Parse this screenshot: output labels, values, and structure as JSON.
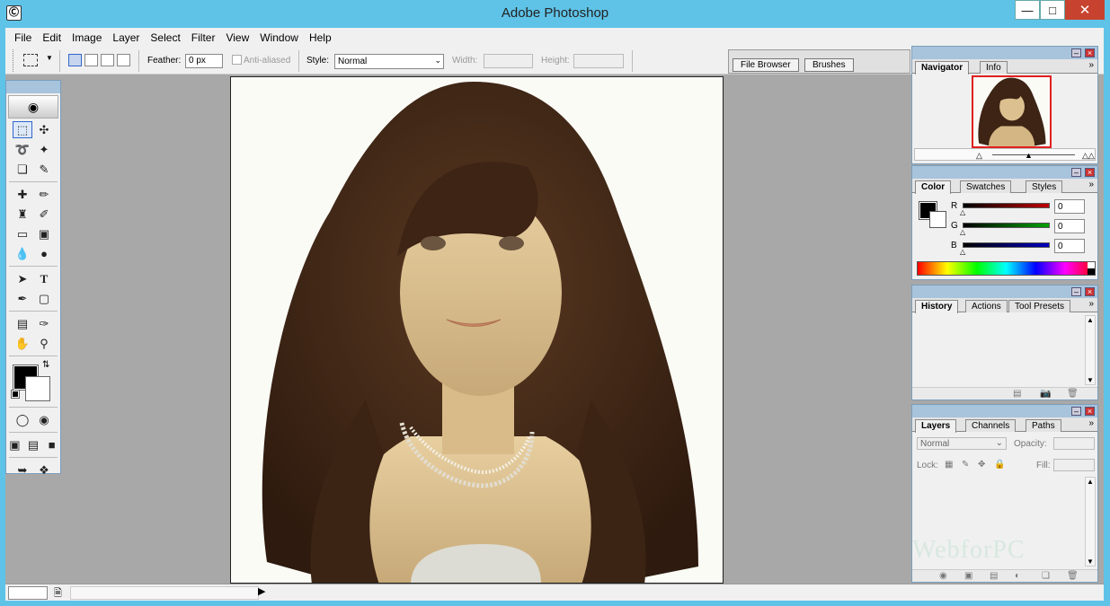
{
  "app": {
    "title": "Adobe Photoshop",
    "icon": "photoshop-icon"
  },
  "window_controls": {
    "minimize": "—",
    "maximize": "□",
    "close": "✕"
  },
  "menu": [
    "File",
    "Edit",
    "Image",
    "Layer",
    "Select",
    "Filter",
    "View",
    "Window",
    "Help"
  ],
  "options": {
    "feather_label": "Feather:",
    "feather_value": "0 px",
    "antialiased_label": "Anti-aliased",
    "style_label": "Style:",
    "style_value": "Normal",
    "width_label": "Width:",
    "height_label": "Height:"
  },
  "palette_well": {
    "tabs": [
      "File Browser",
      "Brushes"
    ]
  },
  "toolbox": {
    "tools": [
      [
        "marquee-tool",
        "move-tool"
      ],
      [
        "lasso-tool",
        "magic-wand-tool"
      ],
      [
        "crop-tool",
        "slice-tool"
      ],
      [
        "healing-brush-tool",
        "brush-tool"
      ],
      [
        "clone-stamp-tool",
        "history-brush-tool"
      ],
      [
        "eraser-tool",
        "gradient-tool"
      ],
      [
        "blur-tool",
        "dodge-tool"
      ],
      [
        "path-selection-tool",
        "type-tool"
      ],
      [
        "pen-tool",
        "shape-tool"
      ],
      [
        "notes-tool",
        "eyedropper-tool"
      ],
      [
        "hand-tool",
        "zoom-tool"
      ]
    ],
    "foreground_color": "#000000",
    "background_color": "#ffffff"
  },
  "navigator_panel": {
    "tabs": [
      "Navigator",
      "Info"
    ],
    "active": "Navigator"
  },
  "color_panel": {
    "tabs": [
      "Color",
      "Swatches",
      "Styles"
    ],
    "active": "Color",
    "channels": [
      {
        "label": "R",
        "value": "0",
        "color": "#c00000"
      },
      {
        "label": "G",
        "value": "0",
        "color": "#00a000"
      },
      {
        "label": "B",
        "value": "0",
        "color": "#0000c0"
      }
    ]
  },
  "history_panel": {
    "tabs": [
      "History",
      "Actions",
      "Tool Presets"
    ],
    "active": "History"
  },
  "layers_panel": {
    "tabs": [
      "Layers",
      "Channels",
      "Paths"
    ],
    "active": "Layers",
    "blend_mode": "Normal",
    "opacity_label": "Opacity:",
    "lock_label": "Lock:",
    "fill_label": "Fill:"
  },
  "watermark": "WebforPC",
  "colors": {
    "titlebar": "#5fc3e8",
    "panel_header": "#a8c4dd",
    "workspace": "#a8a8a8"
  }
}
